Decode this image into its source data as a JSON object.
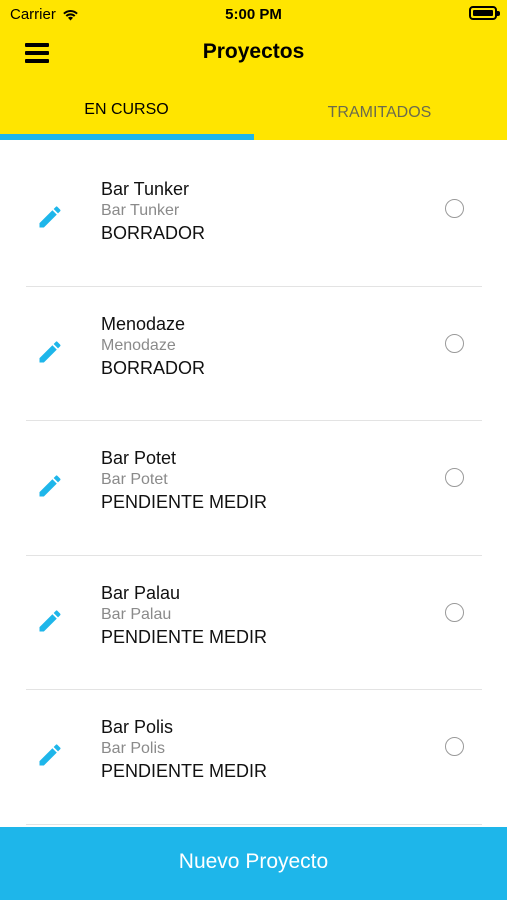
{
  "status_bar": {
    "carrier": "Carrier",
    "time": "5:00 PM"
  },
  "nav": {
    "title": "Proyectos",
    "menu_icon": "hamburger-menu-icon"
  },
  "tabs": [
    {
      "label": "EN CURSO",
      "selected": true
    },
    {
      "label": "TRAMITADOS",
      "selected": false
    }
  ],
  "projects": [
    {
      "title": "Bar Tunker",
      "subtitle": "Bar Tunker",
      "state": "BORRADOR"
    },
    {
      "title": "Menodaze",
      "subtitle": "Menodaze",
      "state": "BORRADOR"
    },
    {
      "title": "Bar Potet",
      "subtitle": "Bar Potet",
      "state": "PENDIENTE MEDIR"
    },
    {
      "title": "Bar Palau",
      "subtitle": "Bar Palau",
      "state": "PENDIENTE MEDIR"
    },
    {
      "title": "Bar Polis",
      "subtitle": "Bar Polis",
      "state": "PENDIENTE MEDIR"
    }
  ],
  "bottom_button": {
    "label": "Nuevo Proyecto"
  },
  "colors": {
    "header": "#FFE500",
    "accent": "#1EB6EA"
  }
}
